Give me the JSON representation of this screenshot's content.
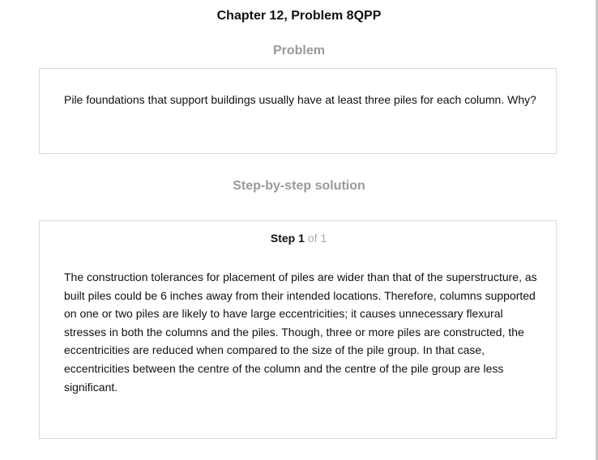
{
  "header": {
    "title": "Chapter 12, Problem 8QPP"
  },
  "problem": {
    "heading": "Problem",
    "text": "Pile foundations that support buildings usually have at least three piles for each column. Why?"
  },
  "solution": {
    "heading": "Step-by-step solution",
    "step": {
      "word": "Step",
      "number": "1",
      "of_text": "of 1"
    },
    "text": "The construction tolerances for placement of piles are wider than that of the superstructure, as built piles could be 6 inches away from their intended locations. Therefore, columns supported on one or two piles are likely to have large eccentricities; it causes unnecessary flexural stresses in both the columns and the piles. Though, three or more piles are constructed, the eccentricities are reduced when compared to the size of the pile group. In that case, eccentricities between the centre of the column and the centre of the pile group are less significant."
  },
  "colors": {
    "heading_gray": "#9a9a9a",
    "border": "#d9d9d9",
    "text": "#111111"
  }
}
